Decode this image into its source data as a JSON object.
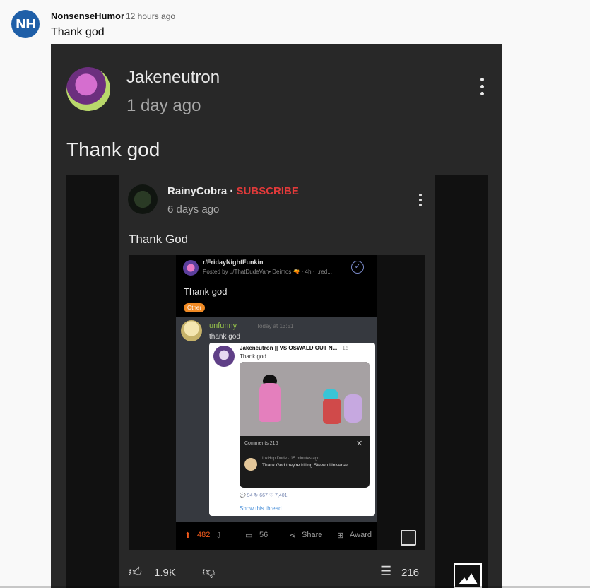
{
  "comment": {
    "avatar_initials": "NH",
    "author": "NonsenseHumor",
    "time": "12 hours ago",
    "text": "Thank god"
  },
  "outer_post": {
    "author": "Jakeneutron",
    "time": "1 day ago",
    "text": "Thank god"
  },
  "inner_post": {
    "author": "RainyCobra",
    "separator": " · ",
    "subscribe": "SUBSCRIBE",
    "time": "6 days ago",
    "text": "Thank God",
    "likes": "1.9K",
    "comments": "216"
  },
  "reddit": {
    "subreddit": "r/FridayNightFunkin",
    "posted_by": "Posted by u/ThatDudeVan• Deimos 🔫 · 4h · i.red...",
    "title": "Thank god",
    "flair": "Other",
    "upvotes": "482",
    "comments": "56",
    "share": "Share",
    "award": "Award"
  },
  "discord": {
    "user": "unfunny",
    "stamp": "Today at 13:51",
    "message": "thank god"
  },
  "embed": {
    "author": "Jakeneutron || VS OSWALD OUT N...",
    "age": "· 1d",
    "text": "Thank god",
    "comments_label": "Comments  216",
    "reply_meta": "InkHup Dude · 15 minutes ago",
    "reply_text": "Thank God they're killing Steven Universe",
    "stats": "💬 94      ↻ 667      ♡ 7,401",
    "show_thread": "Show this thread"
  }
}
